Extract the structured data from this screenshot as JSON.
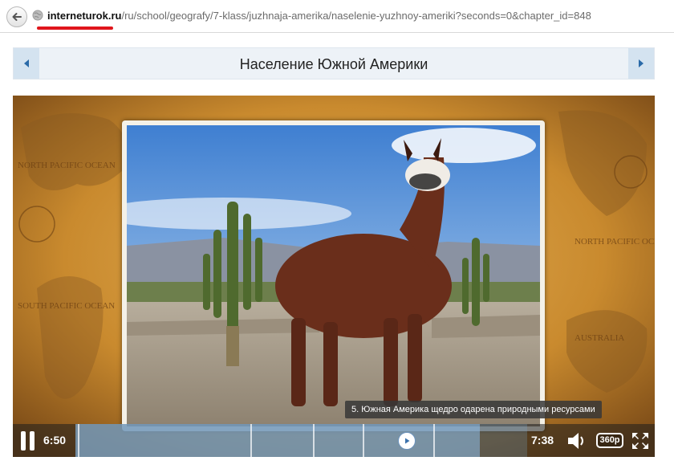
{
  "browser": {
    "url_domain": "interneturok.ru",
    "url_path": "/ru/school/geografy/7-klass/juzhnaja-amerika/naselenie-yuzhnoy-ameriki?seconds=0&chapter_id=848"
  },
  "lesson": {
    "title": "Население Южной Америки"
  },
  "video": {
    "caption": "5. Южная Америка щедро одарена природными ресурсами",
    "current_time": "6:50",
    "total_time": "7:38",
    "progress_fraction": 0.895,
    "quality": "360р",
    "map_labels": [
      "NORTH PACIFIC OCEAN",
      "SOUTH PACIFIC OCEAN",
      "NORTH PACIFIC OCEAN",
      "AUSTRALIA"
    ]
  },
  "colors": {
    "underline": "#e0161c",
    "nav_arrow": "#2a6aa8",
    "title_bg": "#edf2f7"
  }
}
